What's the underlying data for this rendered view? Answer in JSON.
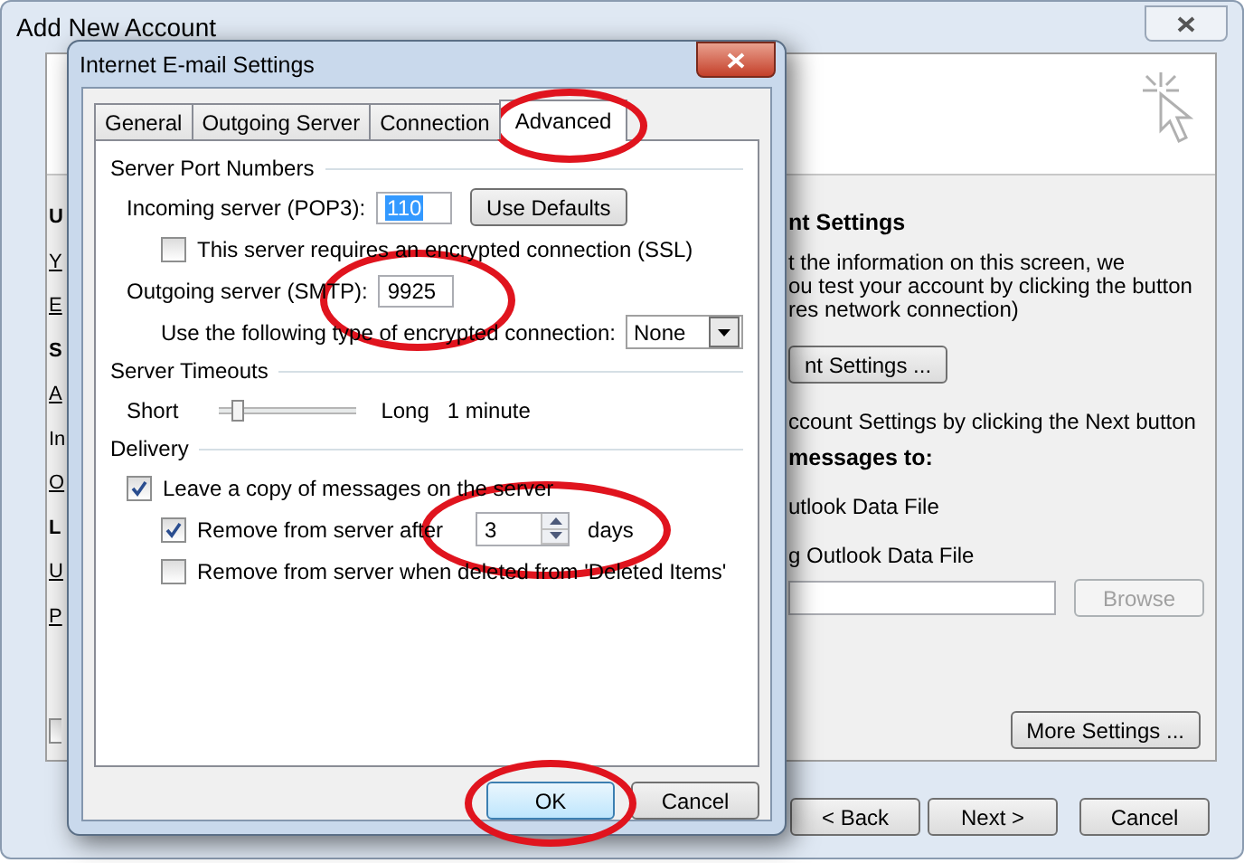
{
  "window": {
    "title": "Add New Account"
  },
  "background_left": [
    {
      "text": "U",
      "kind": "heading"
    },
    {
      "text": "Y",
      "kind": "link"
    },
    {
      "text": "E",
      "kind": "link"
    },
    {
      "text": "S",
      "kind": "heading"
    },
    {
      "text": "A",
      "kind": "link"
    },
    {
      "text": "In",
      "kind": "text"
    },
    {
      "text": "O",
      "kind": "link"
    },
    {
      "text": "L",
      "kind": "heading"
    },
    {
      "text": "U",
      "kind": "link"
    },
    {
      "text": "P",
      "kind": "link"
    }
  ],
  "left_checkbox": {
    "checked": false
  },
  "background_right": {
    "heading": "nt Settings",
    "description": [
      "t the information on this screen, we",
      "ou test your account by clicking the button",
      "res network connection)"
    ],
    "test_button": "nt Settings ...",
    "next_hint": "ccount Settings by clicking the Next button",
    "deliver_heading": "messages to:",
    "options": [
      "utlook Data File",
      "g Outlook Data File"
    ],
    "browse_button": {
      "label": "Browse",
      "disabled": true
    },
    "more_settings_button": "More Settings ..."
  },
  "nav_buttons": [
    "< Back",
    "Next >",
    "Cancel"
  ],
  "dialog": {
    "title": "Internet E-mail Settings",
    "tabs": [
      {
        "label": "General",
        "selected": false,
        "circled": false
      },
      {
        "label": "Outgoing Server",
        "selected": false,
        "circled": false
      },
      {
        "label": "Connection",
        "selected": false,
        "circled": false
      },
      {
        "label": "Advanced",
        "selected": true,
        "circled": true
      }
    ],
    "sections": [
      {
        "title": "Server Port Numbers",
        "rows": [
          {
            "kind": "field",
            "label": "Incoming server (POP3):",
            "value": "110",
            "text_selected": true,
            "button": "Use Defaults",
            "circled": false,
            "children": [
              {
                "kind": "checkbox",
                "label": "This server requires an encrypted connection (SSL)",
                "checked": false
              }
            ]
          },
          {
            "kind": "field",
            "label": "Outgoing server (SMTP):",
            "value": "9925",
            "text_selected": false,
            "circled": true,
            "children": [
              {
                "kind": "select",
                "label": "Use the following type of encrypted connection:",
                "value": "None"
              }
            ]
          }
        ]
      },
      {
        "title": "Server Timeouts",
        "rows": [
          {
            "kind": "slider",
            "left_label": "Short",
            "right_label": "Long",
            "reading": "1 minute",
            "level": 0.1
          }
        ]
      },
      {
        "title": "Delivery",
        "rows": [
          {
            "kind": "checkbox",
            "label": "Leave a copy of messages on the server",
            "checked": true,
            "children": [
              {
                "kind": "checkbox",
                "label": "Remove from server after",
                "checked": true,
                "spin": {
                  "value": "3",
                  "circled": true
                },
                "suffix": "days"
              },
              {
                "kind": "checkbox",
                "label": "Remove from server when deleted from 'Deleted Items'",
                "checked": false
              }
            ]
          }
        ]
      }
    ],
    "buttons": [
      {
        "label": "OK",
        "default": true,
        "circled": true
      },
      {
        "label": "Cancel",
        "default": false,
        "circled": false
      }
    ]
  }
}
